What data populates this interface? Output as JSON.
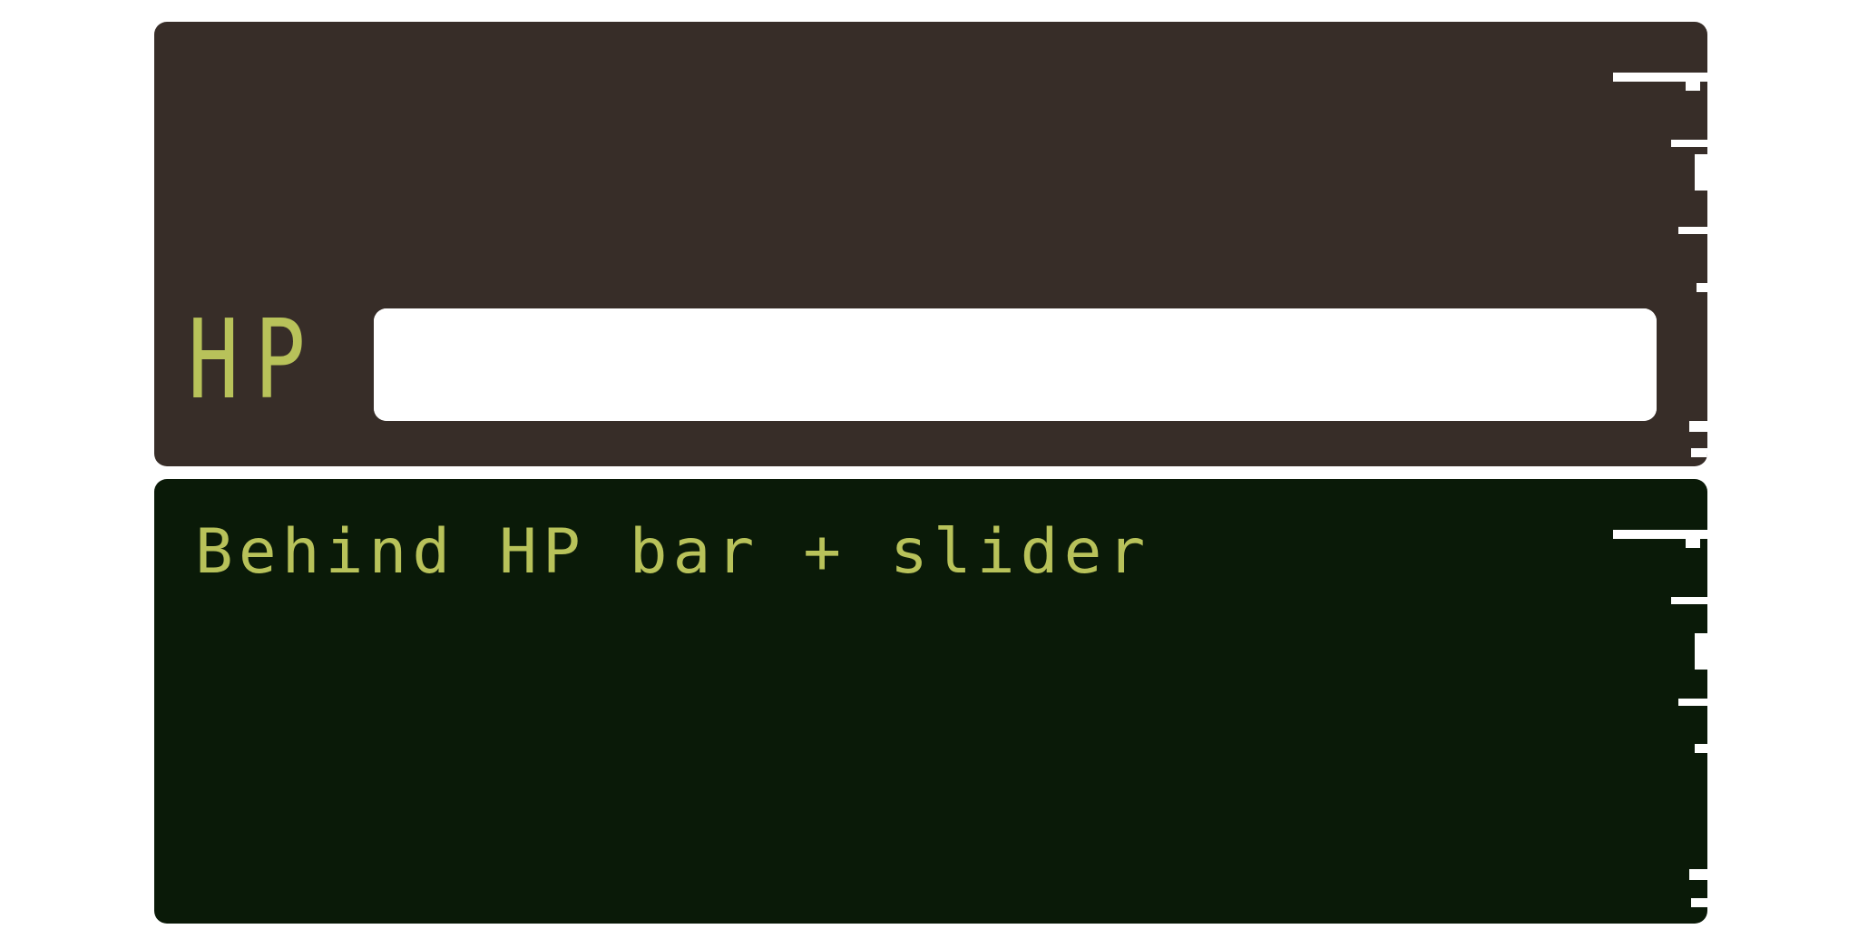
{
  "hud": {
    "hp_label": "HP",
    "hp_value_percent": 100,
    "caption": "Behind HP bar + slider"
  },
  "colors": {
    "top_panel": "#372d28",
    "bottom_panel": "#0a1a08",
    "text_accent": "#b8c25a",
    "bar_fill": "#ffffff"
  }
}
